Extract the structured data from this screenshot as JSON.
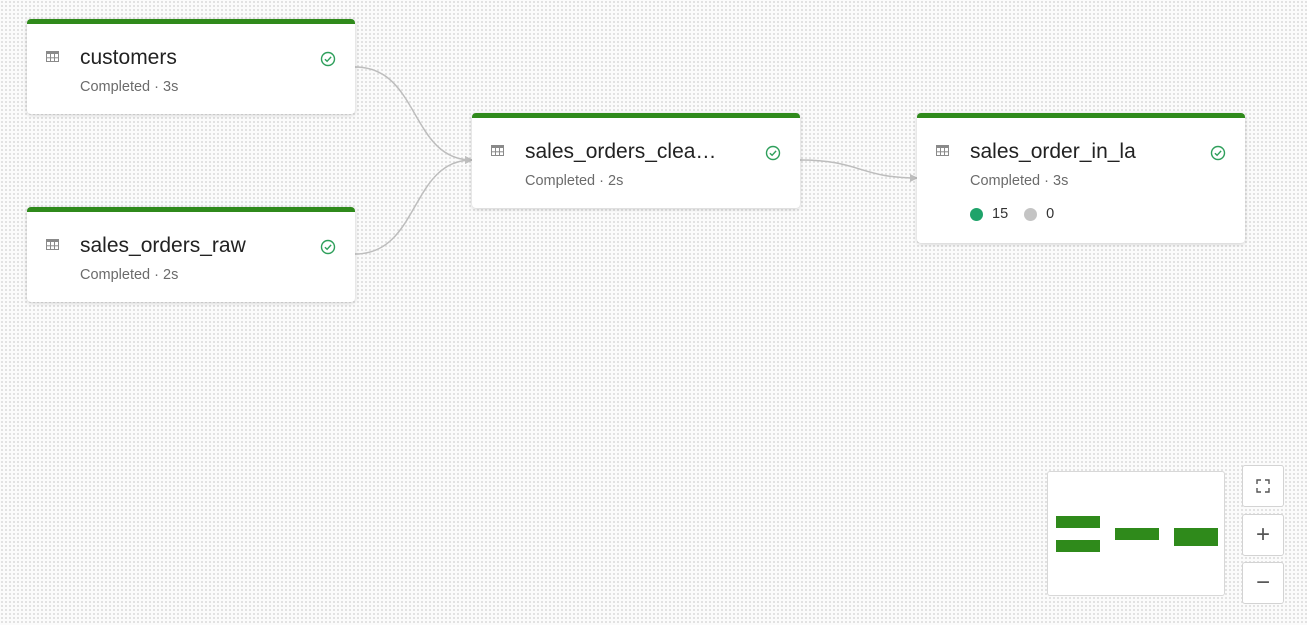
{
  "colors": {
    "node_accent": "#2f8a1b",
    "success": "#2e9f5b",
    "rows_written_dot": "#1fa36a",
    "rows_dropped_dot": "#c4c4c4",
    "edge": "#bdbdbd"
  },
  "nodes": [
    {
      "id": "customers",
      "name": "customers",
      "status": "Completed · 3s",
      "icon": "table-icon",
      "status_icon": "check-circle-icon"
    },
    {
      "id": "sales_orders_raw",
      "name": "sales_orders_raw",
      "status": "Completed · 2s",
      "icon": "table-icon",
      "status_icon": "check-circle-icon"
    },
    {
      "id": "sales_orders_cleaned",
      "name": "sales_orders_clea…",
      "status": "Completed · 2s",
      "icon": "table-icon",
      "status_icon": "check-circle-icon"
    },
    {
      "id": "sales_order_in_la",
      "name": "sales_order_in_la",
      "status": "Completed · 3s",
      "icon": "table-icon",
      "status_icon": "check-circle-icon",
      "metrics": {
        "written": "15",
        "dropped": "0"
      }
    }
  ],
  "controls": {
    "fit": {
      "icon": "fit-view-icon"
    },
    "zoom_in": {
      "label": "+",
      "icon": "plus-icon"
    },
    "zoom_out": {
      "label": "−",
      "icon": "minus-icon"
    }
  }
}
